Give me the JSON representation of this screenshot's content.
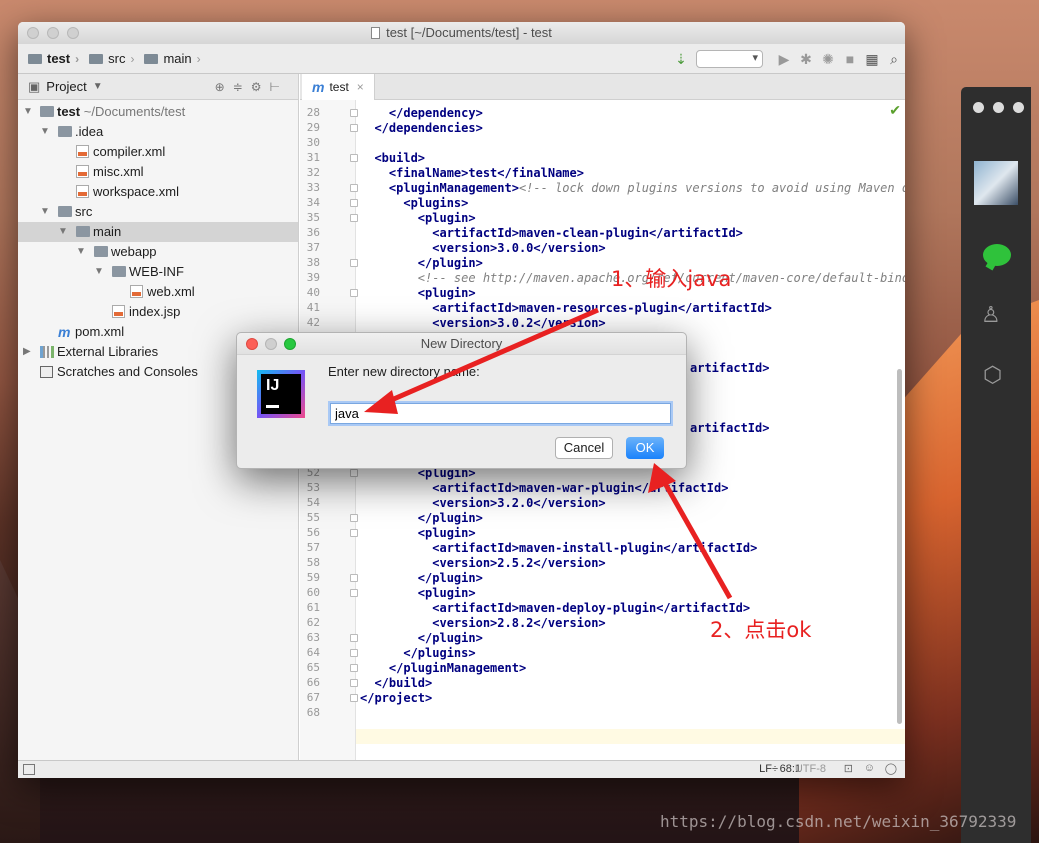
{
  "window": {
    "title": "test [~/Documents/test] - test"
  },
  "breadcrumbs": [
    "test",
    "src",
    "main"
  ],
  "project_panel": {
    "title": "Project",
    "tree": [
      {
        "label": "test",
        "suffix": "~/Documents/test",
        "icon": "folder"
      },
      {
        "label": ".idea",
        "icon": "folder"
      },
      {
        "label": "compiler.xml",
        "icon": "xml"
      },
      {
        "label": "misc.xml",
        "icon": "xml"
      },
      {
        "label": "workspace.xml",
        "icon": "xml"
      },
      {
        "label": "src",
        "icon": "folder"
      },
      {
        "label": "main",
        "icon": "folder"
      },
      {
        "label": "webapp",
        "icon": "folder"
      },
      {
        "label": "WEB-INF",
        "icon": "folder"
      },
      {
        "label": "web.xml",
        "icon": "xml"
      },
      {
        "label": "index.jsp",
        "icon": "jsp"
      },
      {
        "label": "pom.xml",
        "icon": "maven"
      },
      {
        "label": "External Libraries",
        "icon": "library"
      },
      {
        "label": "Scratches and Consoles",
        "icon": "scratch"
      }
    ]
  },
  "editor": {
    "tab_label": "test",
    "line_numbers": [
      "28",
      "29",
      "30",
      "31",
      "32",
      "33",
      "34",
      "35",
      "36",
      "37",
      "38",
      "39",
      "40",
      "41",
      "42",
      "52",
      "53",
      "54",
      "55",
      "56",
      "57",
      "58",
      "59",
      "60",
      "61",
      "62",
      "63",
      "64",
      "65",
      "66",
      "67",
      "68"
    ],
    "lines": {
      "l28": "    </dependency>",
      "l29": "  </dependencies>",
      "l31": "  <build>",
      "l32": "    <finalName>test</finalName>",
      "l33_tag": "    <pluginManagement>",
      "l33_comment": "<!-- lock down plugins versions to avoid using Maven def",
      "l34": "      <plugins>",
      "l35": "        <plugin>",
      "l36": "          <artifactId>maven-clean-plugin</artifactId>",
      "l37": "          <version>3.0.0</version>",
      "l38": "        </plugin>",
      "l39": "        <!-- see http://maven.apache.org/ref/current/maven-core/default-bindin",
      "l40": "        <plugin>",
      "l41": "          <artifactId>maven-resources-plugin</artifactId>",
      "l42": "          <version>3.0.2</version>",
      "l43r": "artifactId>",
      "l47r": "artifactId>",
      "l52": "        <plugin>",
      "l53": "          <artifactId>maven-war-plugin</artifactId>",
      "l54": "          <version>3.2.0</version>",
      "l55": "        </plugin>",
      "l56": "        <plugin>",
      "l57": "          <artifactId>maven-install-plugin</artifactId>",
      "l58": "          <version>2.5.2</version>",
      "l59": "        </plugin>",
      "l60": "        <plugin>",
      "l61": "          <artifactId>maven-deploy-plugin</artifactId>",
      "l62": "          <version>2.8.2</version>",
      "l63": "        </plugin>",
      "l64": "      </plugins>",
      "l65": "    </pluginManagement>",
      "l66": "  </build>",
      "l67": "</project>"
    }
  },
  "status_bar": {
    "position": "68:1",
    "line_sep": "LF÷",
    "encoding": "UTF-8"
  },
  "dialog": {
    "title": "New Directory",
    "prompt": "Enter new directory name:",
    "input_value": "java",
    "cancel_label": "Cancel",
    "ok_label": "OK",
    "icon_text": "IJ"
  },
  "annotations": {
    "step1": "1、输入java",
    "step2": "2、点击ok",
    "color": "#e82121"
  },
  "watermark": "https://blog.csdn.net/weixin_36792339"
}
